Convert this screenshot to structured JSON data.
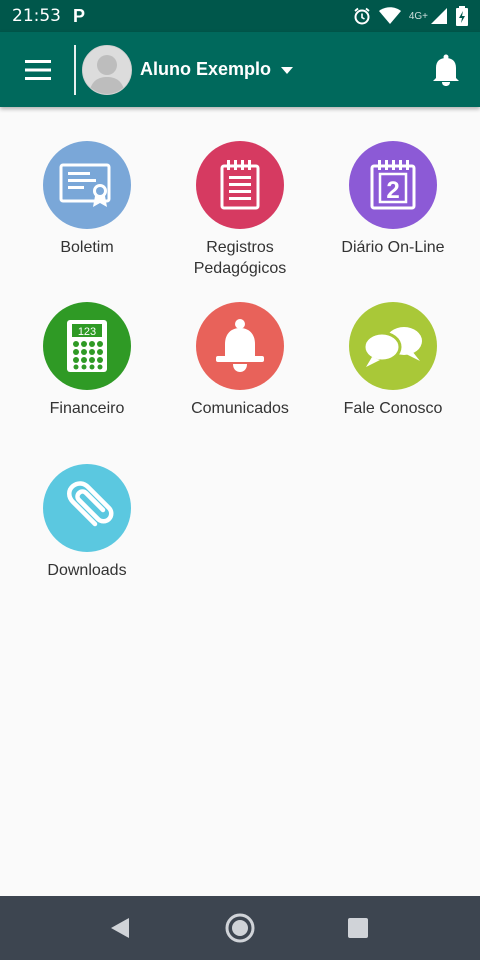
{
  "statusbar": {
    "time": "21:53",
    "app_icon": "P",
    "network": "4G+",
    "icons": [
      "alarm-icon",
      "wifi-icon",
      "signal-icon",
      "battery-icon"
    ]
  },
  "appbar": {
    "user_name": "Aluno Exemplo",
    "menu_icon": "hamburger-icon",
    "notification_icon": "bell-icon",
    "color": "#00695c"
  },
  "tiles": [
    {
      "label": "Boletim",
      "icon": "certificate-icon",
      "color": "#7aa7d8"
    },
    {
      "label": "Registros\nPedagógicos",
      "icon": "notepad-icon",
      "color": "#d63a61"
    },
    {
      "label": "Diário On-Line",
      "icon": "calendar-icon",
      "color": "#8c5ad6"
    },
    {
      "label": "Financeiro",
      "icon": "calculator-icon",
      "color": "#2f9a25"
    },
    {
      "label": "Comunicados",
      "icon": "bell-icon",
      "color": "#e8625a"
    },
    {
      "label": "Fale Conosco",
      "icon": "chat-icon",
      "color": "#a9c838"
    },
    {
      "label": "Downloads",
      "icon": "paperclip-icon",
      "color": "#5bc8e0"
    }
  ],
  "calendar_day": "2",
  "calculator_display": "123",
  "navbar": {
    "buttons": [
      "back-icon",
      "home-icon",
      "recents-icon"
    ]
  }
}
